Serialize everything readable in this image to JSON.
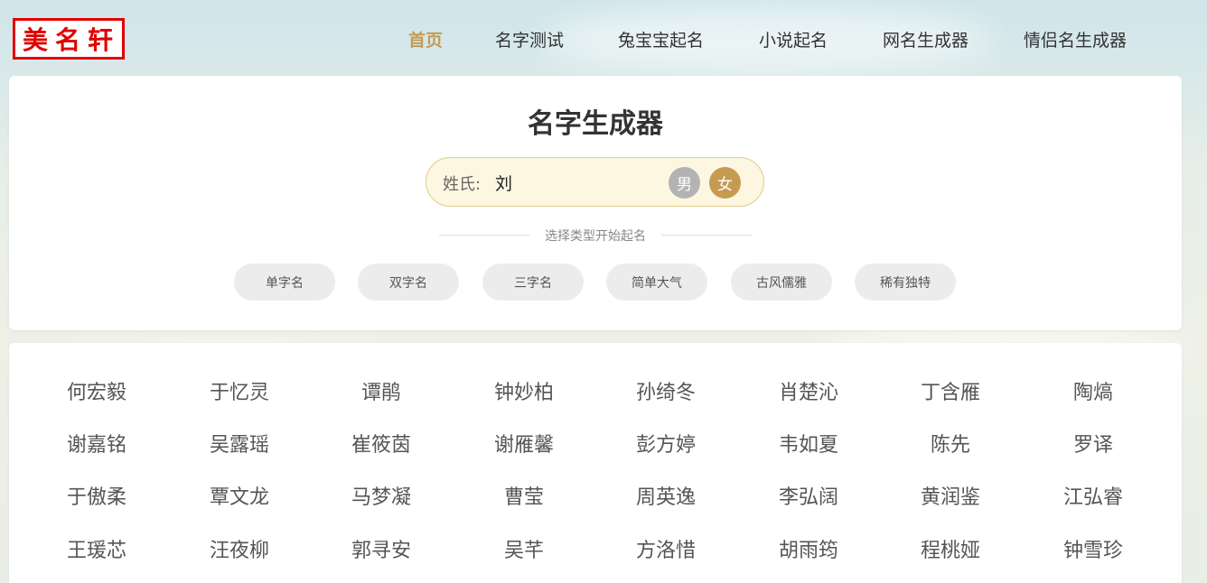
{
  "logo": {
    "text": "美名轩"
  },
  "nav": [
    "首页",
    "名字测试",
    "兔宝宝起名",
    "小说起名",
    "网名生成器",
    "情侣名生成器"
  ],
  "generator": {
    "title": "名字生成器",
    "surname_label": "姓氏:",
    "surname_value": "刘",
    "gender_male": "男",
    "gender_female": "女",
    "divider_text": "选择类型开始起名",
    "types": [
      "单字名",
      "双字名",
      "三字名",
      "简单大气",
      "古风儒雅",
      "稀有独特"
    ]
  },
  "names": [
    [
      "何宏毅",
      "于忆灵",
      "谭鹃",
      "钟妙柏",
      "孙绮冬",
      "肖楚沁",
      "丁含雁",
      "陶熇"
    ],
    [
      "谢嘉铭",
      "吴露瑶",
      "崔筱茵",
      "谢雁馨",
      "彭方婷",
      "韦如夏",
      "陈先",
      "罗译"
    ],
    [
      "于傲柔",
      "覃文龙",
      "马梦凝",
      "曹莹",
      "周英逸",
      "李弘阔",
      "黄润鉴",
      "江弘睿"
    ],
    [
      "王瑗芯",
      "汪夜柳",
      "郭寻安",
      "吴芊",
      "方洛惜",
      "胡雨筠",
      "程桃娅",
      "钟雪珍"
    ]
  ]
}
